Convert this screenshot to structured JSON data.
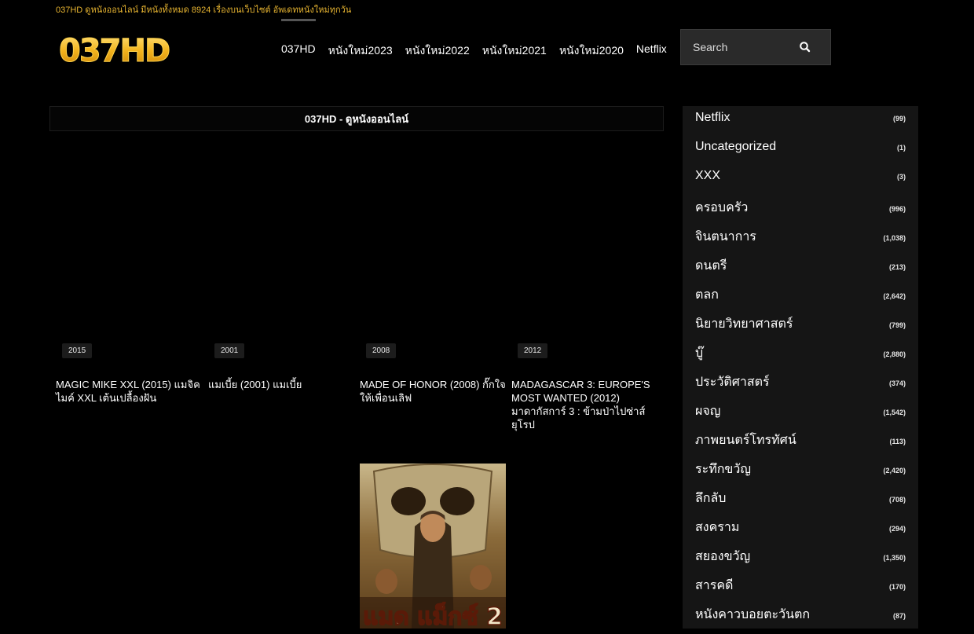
{
  "topbar": {
    "text": "037HD ดูหนังออนไลน์ มีหนังทั้งหมด 8924 เรื่องบนเว็บไซต์ อัพเดทหนังใหม่ทุกวัน"
  },
  "header": {
    "logo_text": "037HD",
    "nav": [
      "037HD",
      "หนังใหม่2023",
      "หนังใหม่2022",
      "หนังใหม่2021",
      "หนังใหม่2020",
      "Netflix"
    ],
    "search_placeholder": "Search"
  },
  "main": {
    "title": "037HD - ดูหนังออนไลน์",
    "movies": [
      {
        "year": "2015",
        "title": "MAGIC MIKE XXL (2015) แมจิค ไมค์ XXL เต้นเปลื้องฝัน"
      },
      {
        "year": "2001",
        "title": "แมเบี้ย (2001) แมเบี้ย"
      },
      {
        "year": "2008",
        "title": "MADE OF HONOR (2008) กั๊กใจให้เพื่อนเลิฟ"
      },
      {
        "year": "2012",
        "title": "MADAGASCAR 3: EUROPE'S MOST WANTED (2012) มาดากัสการ์ 3 : ข้ามป่าไปซ่าส์ยุโรป"
      }
    ],
    "poster_text": "แมด แม็กซ์ 2"
  },
  "sidebar": {
    "categories": [
      {
        "name": "Netflix",
        "count": "(99)"
      },
      {
        "name": "Uncategorized",
        "count": "(1)"
      },
      {
        "name": "XXX",
        "count": "(3)"
      },
      {
        "name": "ครอบครัว",
        "count": "(996)"
      },
      {
        "name": "จินตนาการ",
        "count": "(1,038)"
      },
      {
        "name": "ดนตรี",
        "count": "(213)"
      },
      {
        "name": "ตลก",
        "count": "(2,642)"
      },
      {
        "name": "นิยายวิทยาศาสตร์",
        "count": "(799)"
      },
      {
        "name": "บู๊",
        "count": "(2,880)"
      },
      {
        "name": "ประวัติศาสตร์",
        "count": "(374)"
      },
      {
        "name": "ผจญ",
        "count": "(1,542)"
      },
      {
        "name": "ภาพยนตร์โทรทัศน์",
        "count": "(113)"
      },
      {
        "name": "ระทึกขวัญ",
        "count": "(2,420)"
      },
      {
        "name": "ลึกลับ",
        "count": "(708)"
      },
      {
        "name": "สงคราม",
        "count": "(294)"
      },
      {
        "name": "สยองขวัญ",
        "count": "(1,350)"
      },
      {
        "name": "สารคดี",
        "count": "(170)"
      },
      {
        "name": "หนังคาวบอยตะวันตก",
        "count": "(87)"
      }
    ]
  },
  "colors": {
    "accent": "#e8b531",
    "background": "#000000",
    "sidebar_bg": "#151515"
  }
}
